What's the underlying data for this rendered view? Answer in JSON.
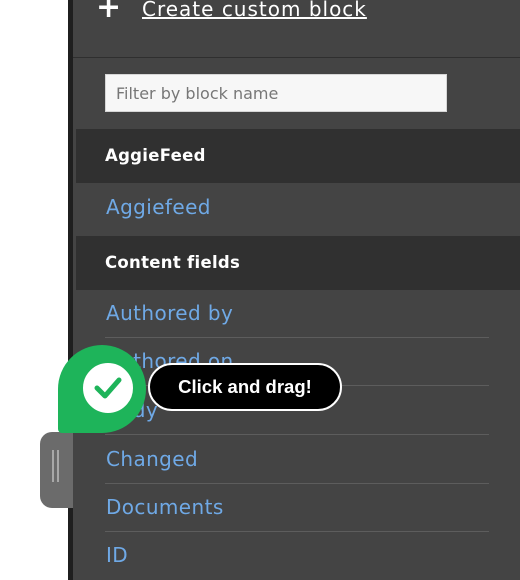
{
  "header": {
    "create_icon": "plus-icon",
    "create_label": "Create custom block"
  },
  "filter": {
    "placeholder": "Filter by block name",
    "value": ""
  },
  "categories": [
    {
      "title": "AggieFeed",
      "items": [
        {
          "label": "Aggiefeed"
        }
      ]
    },
    {
      "title": "Content fields",
      "items": [
        {
          "label": "Authored by"
        },
        {
          "label": "Authored on"
        },
        {
          "label": "Body"
        },
        {
          "label": "Changed"
        },
        {
          "label": "Documents"
        },
        {
          "label": "ID"
        }
      ]
    }
  ],
  "tour": {
    "tooltip": "Click and drag!",
    "icon": "checkmark-icon",
    "accent": "#1eb45a"
  },
  "colors": {
    "panel": "#444444",
    "header": "#303030",
    "link": "#6fa9e6"
  }
}
